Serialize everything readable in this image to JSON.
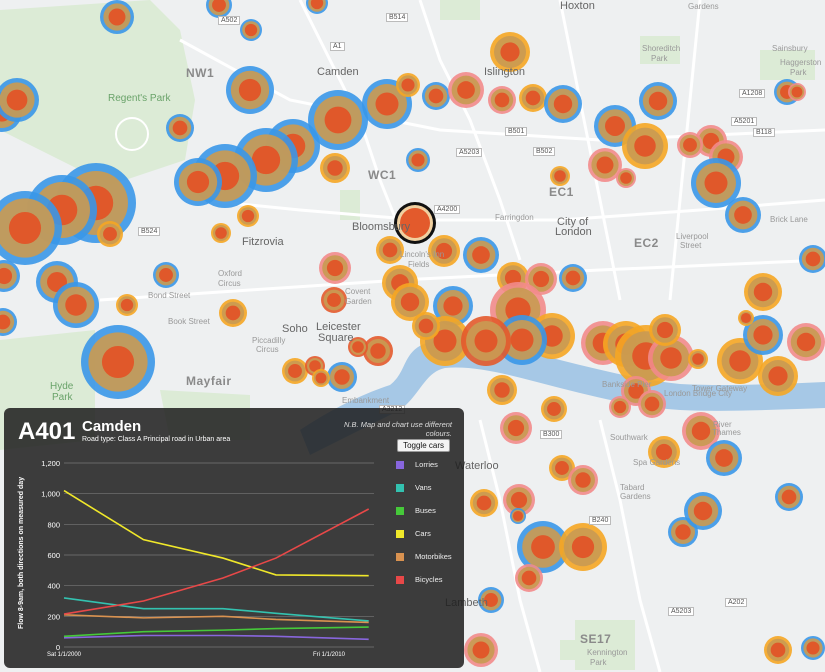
{
  "map": {
    "places": [
      {
        "text": "Camden",
        "cls": "big",
        "x": 317,
        "y": 66
      },
      {
        "text": "NW1",
        "cls": "area",
        "x": 186,
        "y": 66
      },
      {
        "text": "Islington",
        "cls": "big",
        "x": 484,
        "y": 66
      },
      {
        "text": "Hoxton",
        "cls": "big",
        "x": 560,
        "y": 0
      },
      {
        "text": "Regent's Park",
        "cls": "park",
        "x": 108,
        "y": 93
      },
      {
        "text": "WC1",
        "cls": "area",
        "x": 368,
        "y": 168
      },
      {
        "text": "EC1",
        "cls": "area",
        "x": 549,
        "y": 185
      },
      {
        "text": "EC2",
        "cls": "area",
        "x": 634,
        "y": 236
      },
      {
        "text": "Bloomsbury",
        "cls": "big",
        "x": 352,
        "y": 221
      },
      {
        "text": "Fitzrovia",
        "cls": "big",
        "x": 242,
        "y": 236
      },
      {
        "text": "City of",
        "cls": "big",
        "x": 557,
        "y": 216
      },
      {
        "text": "London",
        "cls": "big",
        "x": 555,
        "y": 226
      },
      {
        "text": "Farringdon",
        "cls": "small",
        "x": 495,
        "y": 213
      },
      {
        "text": "Bond Street",
        "cls": "small",
        "x": 148,
        "y": 291
      },
      {
        "text": "Book Street",
        "cls": "small",
        "x": 168,
        "y": 317
      },
      {
        "text": "Soho",
        "cls": "big",
        "x": 282,
        "y": 323
      },
      {
        "text": "Leicester",
        "cls": "big",
        "x": 316,
        "y": 321
      },
      {
        "text": "Square",
        "cls": "big",
        "x": 318,
        "y": 332
      },
      {
        "text": "Covent",
        "cls": "small",
        "x": 345,
        "y": 287
      },
      {
        "text": "Garden",
        "cls": "small",
        "x": 345,
        "y": 297
      },
      {
        "text": "Mayfair",
        "cls": "area",
        "x": 186,
        "y": 374
      },
      {
        "text": "Hyde",
        "cls": "park",
        "x": 50,
        "y": 381
      },
      {
        "text": "Park",
        "cls": "park",
        "x": 52,
        "y": 392
      },
      {
        "text": "Liverpool",
        "cls": "small",
        "x": 676,
        "y": 232
      },
      {
        "text": "Street",
        "cls": "small",
        "x": 680,
        "y": 241
      },
      {
        "text": "Bankside Pier",
        "cls": "small",
        "x": 602,
        "y": 380
      },
      {
        "text": "Tower Gateway",
        "cls": "small",
        "x": 692,
        "y": 384
      },
      {
        "text": "London Bridge City",
        "cls": "small",
        "x": 664,
        "y": 389
      },
      {
        "text": "River",
        "cls": "small",
        "x": 713,
        "y": 420
      },
      {
        "text": "Thames",
        "cls": "small",
        "x": 712,
        "y": 428
      },
      {
        "text": "Waterloo",
        "cls": "big",
        "x": 455,
        "y": 460
      },
      {
        "text": "Lambeth",
        "cls": "big",
        "x": 445,
        "y": 597
      },
      {
        "text": "SE17",
        "cls": "area",
        "x": 580,
        "y": 632
      },
      {
        "text": "Embankment",
        "cls": "small",
        "x": 342,
        "y": 396
      },
      {
        "text": "Sainsbury",
        "cls": "small",
        "x": 772,
        "y": 44
      },
      {
        "text": "Gardens",
        "cls": "small",
        "x": 688,
        "y": 2
      },
      {
        "text": "Shoreditch",
        "cls": "small",
        "x": 642,
        "y": 44
      },
      {
        "text": "Park",
        "cls": "small",
        "x": 651,
        "y": 54
      },
      {
        "text": "Haggerston",
        "cls": "small",
        "x": 780,
        "y": 58
      },
      {
        "text": "Park",
        "cls": "small",
        "x": 790,
        "y": 68
      },
      {
        "text": "Brick Lane",
        "cls": "small",
        "x": 770,
        "y": 215
      },
      {
        "text": "Lincoln's Inn",
        "cls": "small",
        "x": 400,
        "y": 250
      },
      {
        "text": "Fields",
        "cls": "small",
        "x": 408,
        "y": 260
      },
      {
        "text": "Piccadilly",
        "cls": "small",
        "x": 252,
        "y": 336
      },
      {
        "text": "Circus",
        "cls": "small",
        "x": 256,
        "y": 345
      },
      {
        "text": "Oxford",
        "cls": "small",
        "x": 218,
        "y": 269
      },
      {
        "text": "Circus",
        "cls": "small",
        "x": 218,
        "y": 279
      },
      {
        "text": "Southwark",
        "cls": "small",
        "x": 610,
        "y": 433
      },
      {
        "text": "Spa Gardens",
        "cls": "small",
        "x": 633,
        "y": 458
      },
      {
        "text": "Tabard",
        "cls": "small",
        "x": 620,
        "y": 483
      },
      {
        "text": "Gardens",
        "cls": "small",
        "x": 620,
        "y": 492
      },
      {
        "text": "Kennington",
        "cls": "small",
        "x": 587,
        "y": 648
      },
      {
        "text": "Park",
        "cls": "small",
        "x": 590,
        "y": 658
      }
    ],
    "roads": [
      {
        "text": "A502",
        "x": 218,
        "y": 16
      },
      {
        "text": "B514",
        "x": 386,
        "y": 13
      },
      {
        "text": "A1",
        "x": 330,
        "y": 42
      },
      {
        "text": "B501",
        "x": 505,
        "y": 127
      },
      {
        "text": "B502",
        "x": 533,
        "y": 147
      },
      {
        "text": "A5203",
        "x": 456,
        "y": 148
      },
      {
        "text": "A1208",
        "x": 739,
        "y": 89
      },
      {
        "text": "A5201",
        "x": 731,
        "y": 117
      },
      {
        "text": "B118",
        "x": 753,
        "y": 128
      },
      {
        "text": "A4200",
        "x": 434,
        "y": 205
      },
      {
        "text": "B524",
        "x": 138,
        "y": 227
      },
      {
        "text": "B300",
        "x": 540,
        "y": 430
      },
      {
        "text": "B240",
        "x": 589,
        "y": 516
      },
      {
        "text": "A202",
        "x": 725,
        "y": 598
      },
      {
        "text": "A5203",
        "x": 668,
        "y": 607
      },
      {
        "text": "A3212",
        "x": 379,
        "y": 405
      }
    ],
    "circles": [
      {
        "x": 117,
        "y": 17,
        "r": 17,
        "outer": "#3a97e8"
      },
      {
        "x": 219,
        "y": 5,
        "r": 13,
        "outer": "#3a97e8"
      },
      {
        "x": 251,
        "y": 30,
        "r": 11,
        "outer": "#3a97e8"
      },
      {
        "x": 317,
        "y": 3,
        "r": 11,
        "outer": "#3a97e8"
      },
      {
        "x": 2,
        "y": 112,
        "r": 20,
        "outer": "#3a97e8"
      },
      {
        "x": 17,
        "y": 100,
        "r": 22,
        "outer": "#3a97e8"
      },
      {
        "x": 250,
        "y": 90,
        "r": 24,
        "outer": "#3a97e8"
      },
      {
        "x": 180,
        "y": 128,
        "r": 14,
        "outer": "#3a97e8"
      },
      {
        "x": 338,
        "y": 120,
        "r": 30,
        "outer": "#3a97e8"
      },
      {
        "x": 387,
        "y": 104,
        "r": 25,
        "outer": "#3a97e8"
      },
      {
        "x": 408,
        "y": 85,
        "r": 12,
        "outer": "#f5a623"
      },
      {
        "x": 436,
        "y": 96,
        "r": 14,
        "outer": "#3a97e8"
      },
      {
        "x": 293,
        "y": 146,
        "r": 27,
        "outer": "#3a97e8"
      },
      {
        "x": 266,
        "y": 160,
        "r": 32,
        "outer": "#3a97e8"
      },
      {
        "x": 225,
        "y": 176,
        "r": 32,
        "outer": "#3a97e8"
      },
      {
        "x": 198,
        "y": 182,
        "r": 24,
        "outer": "#3a97e8"
      },
      {
        "x": 96,
        "y": 203,
        "r": 40,
        "outer": "#3a97e8"
      },
      {
        "x": 62,
        "y": 210,
        "r": 35,
        "outer": "#3a97e8"
      },
      {
        "x": 25,
        "y": 228,
        "r": 37,
        "outer": "#3a97e8"
      },
      {
        "x": 110,
        "y": 234,
        "r": 13,
        "outer": "#f5a623"
      },
      {
        "x": 335,
        "y": 168,
        "r": 15,
        "outer": "#f5a623"
      },
      {
        "x": 418,
        "y": 160,
        "r": 12,
        "outer": "#3a97e8"
      },
      {
        "x": 510,
        "y": 52,
        "r": 20,
        "outer": "#f5a623"
      },
      {
        "x": 466,
        "y": 90,
        "r": 18,
        "outer": "#f28b8b"
      },
      {
        "x": 502,
        "y": 100,
        "r": 14,
        "outer": "#f28b8b"
      },
      {
        "x": 533,
        "y": 98,
        "r": 14,
        "outer": "#f5a623"
      },
      {
        "x": 563,
        "y": 104,
        "r": 19,
        "outer": "#3a97e8"
      },
      {
        "x": 615,
        "y": 126,
        "r": 21,
        "outer": "#3a97e8"
      },
      {
        "x": 645,
        "y": 146,
        "r": 23,
        "outer": "#f5a623"
      },
      {
        "x": 658,
        "y": 101,
        "r": 19,
        "outer": "#3a97e8"
      },
      {
        "x": 711,
        "y": 141,
        "r": 16,
        "outer": "#f28b8b"
      },
      {
        "x": 726,
        "y": 157,
        "r": 17,
        "outer": "#f28b8b"
      },
      {
        "x": 690,
        "y": 145,
        "r": 13,
        "outer": "#f28b8b"
      },
      {
        "x": 605,
        "y": 165,
        "r": 17,
        "outer": "#f28b8b"
      },
      {
        "x": 626,
        "y": 178,
        "r": 10,
        "outer": "#f28b8b"
      },
      {
        "x": 716,
        "y": 183,
        "r": 25,
        "outer": "#3a97e8"
      },
      {
        "x": 743,
        "y": 215,
        "r": 18,
        "outer": "#3a97e8"
      },
      {
        "x": 787,
        "y": 92,
        "r": 13,
        "outer": "#3a97e8"
      },
      {
        "x": 797,
        "y": 92,
        "r": 9,
        "outer": "#f28b8b"
      },
      {
        "x": 560,
        "y": 176,
        "r": 10,
        "outer": "#f5a623"
      },
      {
        "x": 415,
        "y": 223,
        "r": 21,
        "outer": "#111111"
      },
      {
        "x": 390,
        "y": 250,
        "r": 14,
        "outer": "#f5a623"
      },
      {
        "x": 444,
        "y": 251,
        "r": 16,
        "outer": "#f5a623"
      },
      {
        "x": 481,
        "y": 255,
        "r": 18,
        "outer": "#3a97e8"
      },
      {
        "x": 221,
        "y": 233,
        "r": 10,
        "outer": "#f5a623"
      },
      {
        "x": 248,
        "y": 216,
        "r": 11,
        "outer": "#f5a623"
      },
      {
        "x": 166,
        "y": 275,
        "r": 13,
        "outer": "#3a97e8"
      },
      {
        "x": 57,
        "y": 282,
        "r": 21,
        "outer": "#3a97e8"
      },
      {
        "x": 76,
        "y": 305,
        "r": 23,
        "outer": "#3a97e8"
      },
      {
        "x": 127,
        "y": 305,
        "r": 11,
        "outer": "#f5a623"
      },
      {
        "x": 118,
        "y": 362,
        "r": 37,
        "outer": "#3a97e8"
      },
      {
        "x": 4,
        "y": 276,
        "r": 16,
        "outer": "#3a97e8"
      },
      {
        "x": 3,
        "y": 322,
        "r": 14,
        "outer": "#3a97e8"
      },
      {
        "x": 233,
        "y": 313,
        "r": 14,
        "outer": "#f5a623"
      },
      {
        "x": 335,
        "y": 268,
        "r": 16,
        "outer": "#f28b8b"
      },
      {
        "x": 334,
        "y": 300,
        "r": 13,
        "outer": "#e35a2c"
      },
      {
        "x": 400,
        "y": 283,
        "r": 18,
        "outer": "#f5a623"
      },
      {
        "x": 410,
        "y": 302,
        "r": 19,
        "outer": "#f5a623"
      },
      {
        "x": 453,
        "y": 306,
        "r": 20,
        "outer": "#3a97e8"
      },
      {
        "x": 513,
        "y": 278,
        "r": 16,
        "outer": "#f5a623"
      },
      {
        "x": 541,
        "y": 279,
        "r": 16,
        "outer": "#f28b8b"
      },
      {
        "x": 573,
        "y": 278,
        "r": 14,
        "outer": "#3a97e8"
      },
      {
        "x": 518,
        "y": 310,
        "r": 28,
        "outer": "#f28b8b"
      },
      {
        "x": 552,
        "y": 336,
        "r": 23,
        "outer": "#f5a623"
      },
      {
        "x": 522,
        "y": 340,
        "r": 25,
        "outer": "#3a97e8"
      },
      {
        "x": 445,
        "y": 341,
        "r": 25,
        "outer": "#f5a623"
      },
      {
        "x": 486,
        "y": 341,
        "r": 25,
        "outer": "#e35a2c"
      },
      {
        "x": 426,
        "y": 326,
        "r": 14,
        "outer": "#f5a623"
      },
      {
        "x": 378,
        "y": 351,
        "r": 15,
        "outer": "#e35a2c"
      },
      {
        "x": 358,
        "y": 347,
        "r": 10,
        "outer": "#e35a2c"
      },
      {
        "x": 295,
        "y": 371,
        "r": 13,
        "outer": "#f5a623"
      },
      {
        "x": 315,
        "y": 366,
        "r": 10,
        "outer": "#e35a2c"
      },
      {
        "x": 342,
        "y": 377,
        "r": 15,
        "outer": "#3a97e8"
      },
      {
        "x": 321,
        "y": 378,
        "r": 9,
        "outer": "#f5a623"
      },
      {
        "x": 502,
        "y": 390,
        "r": 15,
        "outer": "#f5a623"
      },
      {
        "x": 554,
        "y": 409,
        "r": 13,
        "outer": "#f5a623"
      },
      {
        "x": 516,
        "y": 428,
        "r": 16,
        "outer": "#f28b8b"
      },
      {
        "x": 603,
        "y": 343,
        "r": 22,
        "outer": "#f28b8b"
      },
      {
        "x": 626,
        "y": 344,
        "r": 23,
        "outer": "#f5a623"
      },
      {
        "x": 646,
        "y": 356,
        "r": 31,
        "outer": "#f5a623"
      },
      {
        "x": 671,
        "y": 358,
        "r": 23,
        "outer": "#f28b8b"
      },
      {
        "x": 665,
        "y": 330,
        "r": 16,
        "outer": "#f5a623"
      },
      {
        "x": 740,
        "y": 361,
        "r": 23,
        "outer": "#f5a623"
      },
      {
        "x": 778,
        "y": 376,
        "r": 20,
        "outer": "#f5a623"
      },
      {
        "x": 806,
        "y": 342,
        "r": 19,
        "outer": "#f28b8b"
      },
      {
        "x": 763,
        "y": 335,
        "r": 20,
        "outer": "#3a97e8"
      },
      {
        "x": 763,
        "y": 292,
        "r": 19,
        "outer": "#f5a623"
      },
      {
        "x": 813,
        "y": 259,
        "r": 14,
        "outer": "#3a97e8"
      },
      {
        "x": 746,
        "y": 318,
        "r": 8,
        "outer": "#f5a623"
      },
      {
        "x": 698,
        "y": 359,
        "r": 10,
        "outer": "#f5a623"
      },
      {
        "x": 636,
        "y": 391,
        "r": 15,
        "outer": "#f28b8b"
      },
      {
        "x": 652,
        "y": 404,
        "r": 14,
        "outer": "#f28b8b"
      },
      {
        "x": 620,
        "y": 407,
        "r": 11,
        "outer": "#f28b8b"
      },
      {
        "x": 701,
        "y": 431,
        "r": 19,
        "outer": "#f28b8b"
      },
      {
        "x": 724,
        "y": 458,
        "r": 18,
        "outer": "#3a97e8"
      },
      {
        "x": 664,
        "y": 452,
        "r": 16,
        "outer": "#f5a623"
      },
      {
        "x": 562,
        "y": 468,
        "r": 13,
        "outer": "#f5a623"
      },
      {
        "x": 583,
        "y": 480,
        "r": 15,
        "outer": "#f28b8b"
      },
      {
        "x": 484,
        "y": 503,
        "r": 14,
        "outer": "#f5a623"
      },
      {
        "x": 519,
        "y": 500,
        "r": 16,
        "outer": "#f28b8b"
      },
      {
        "x": 518,
        "y": 516,
        "r": 8,
        "outer": "#3a97e8"
      },
      {
        "x": 543,
        "y": 547,
        "r": 26,
        "outer": "#3a97e8"
      },
      {
        "x": 583,
        "y": 547,
        "r": 24,
        "outer": "#f5a623"
      },
      {
        "x": 529,
        "y": 578,
        "r": 14,
        "outer": "#f28b8b"
      },
      {
        "x": 491,
        "y": 600,
        "r": 13,
        "outer": "#3a97e8"
      },
      {
        "x": 481,
        "y": 650,
        "r": 17,
        "outer": "#f28b8b"
      },
      {
        "x": 683,
        "y": 532,
        "r": 15,
        "outer": "#3a97e8"
      },
      {
        "x": 703,
        "y": 511,
        "r": 19,
        "outer": "#3a97e8"
      },
      {
        "x": 789,
        "y": 497,
        "r": 14,
        "outer": "#3a97e8"
      },
      {
        "x": 778,
        "y": 650,
        "r": 14,
        "outer": "#f5a623"
      },
      {
        "x": 813,
        "y": 648,
        "r": 12,
        "outer": "#3a97e8"
      }
    ]
  },
  "panel": {
    "road_id": "A401",
    "area_name": "Camden",
    "road_type": "Road type: Class A Principal road in Urban area",
    "note": "N.B. Map and chart use different colours.",
    "toggle_label": "Toggle cars",
    "legend": [
      {
        "label": "Lorries",
        "color": "#8866dd"
      },
      {
        "label": "Vans",
        "color": "#33c2b0"
      },
      {
        "label": "Buses",
        "color": "#46c93a"
      },
      {
        "label": "Cars",
        "color": "#f0e82a"
      },
      {
        "label": "Motorbikes",
        "color": "#d99250"
      },
      {
        "label": "Bicycles",
        "color": "#e84848"
      }
    ]
  },
  "chart_data": {
    "type": "line",
    "ylabel": "Flow 8-9am, both directions on measured day",
    "ylim": [
      0,
      1200
    ],
    "yticks": [
      0,
      200,
      400,
      600,
      800,
      1000,
      1200
    ],
    "ytick_labels": [
      "0",
      "200",
      "400",
      "600",
      "800",
      "1,000",
      "1,200"
    ],
    "xlim": [
      2000,
      2011.7
    ],
    "xticks": [
      {
        "value": 2000,
        "label": "Sat 1/1/2000"
      },
      {
        "value": 2010,
        "label": "Fri 1/1/2010"
      }
    ],
    "x": [
      2000,
      2003,
      2006,
      2008,
      2011.5
    ],
    "series": [
      {
        "name": "Lorries",
        "color": "#8866dd",
        "values": [
          60,
          75,
          75,
          70,
          50
        ]
      },
      {
        "name": "Vans",
        "color": "#33c2b0",
        "values": [
          320,
          250,
          250,
          220,
          170
        ]
      },
      {
        "name": "Buses",
        "color": "#46c93a",
        "values": [
          70,
          100,
          110,
          120,
          130
        ]
      },
      {
        "name": "Cars",
        "color": "#f0e82a",
        "values": [
          1020,
          700,
          580,
          470,
          465
        ]
      },
      {
        "name": "Motorbikes",
        "color": "#d99250",
        "values": [
          210,
          190,
          200,
          180,
          160
        ]
      },
      {
        "name": "Bicycles",
        "color": "#e84848",
        "values": [
          215,
          300,
          450,
          580,
          900
        ]
      }
    ]
  }
}
